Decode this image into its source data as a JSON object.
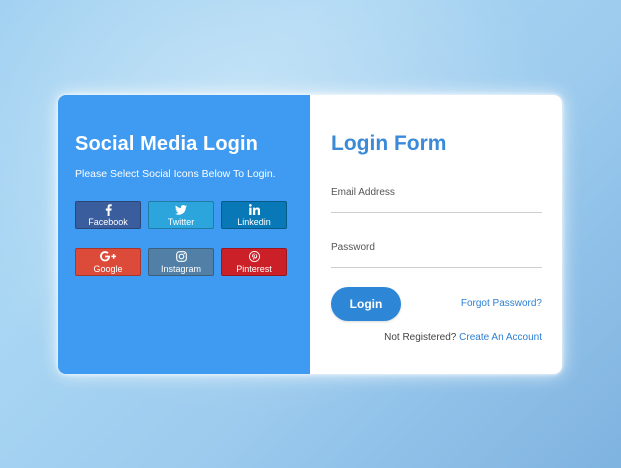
{
  "social_panel": {
    "title": "Social Media Login",
    "subtitle": "Please Select Social Icons Below To Login.",
    "buttons": [
      {
        "label": "Facebook",
        "icon": "facebook-icon",
        "color": "#3a5d9d"
      },
      {
        "label": "Twitter",
        "icon": "twitter-icon",
        "color": "#2ba5dc"
      },
      {
        "label": "Linkedin",
        "icon": "linkedin-icon",
        "color": "#0879b6"
      },
      {
        "label": "Google",
        "icon": "google-plus-icon",
        "color": "#dc4b3a"
      },
      {
        "label": "Instagram",
        "icon": "instagram-icon",
        "color": "#517fa6"
      },
      {
        "label": "Pinterest",
        "icon": "pinterest-icon",
        "color": "#cb2027"
      }
    ],
    "background_color": "#3f9af1"
  },
  "login_form": {
    "title": "Login Form",
    "email": {
      "label": "Email Address",
      "value": "",
      "placeholder": "Email Address"
    },
    "password": {
      "label": "Password",
      "value": "",
      "placeholder": "Password"
    },
    "login_button": "Login",
    "forgot_password": "Forgot Password?",
    "not_registered": "Not Registered?",
    "create_account": "Create An Account",
    "accent_color": "#2e86d6"
  }
}
